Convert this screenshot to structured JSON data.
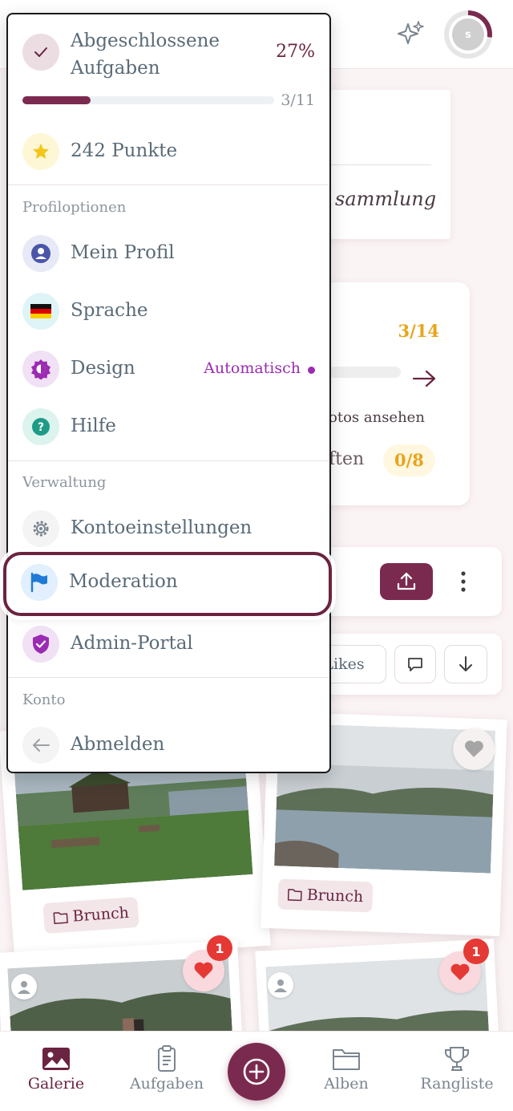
{
  "topbar": {
    "avatar_initial": "s"
  },
  "background": {
    "album_card_text": "sammlung",
    "task_card": {
      "count": "3/14",
      "line1": "otos ansehen",
      "line2": "ften",
      "sub_count": "0/8"
    },
    "sort": {
      "likes_label": "Likes"
    }
  },
  "photos": [
    {
      "tag": "Brunch"
    },
    {
      "tag": "Brunch"
    },
    {
      "likes_count": "1"
    },
    {
      "likes_count": "1"
    }
  ],
  "menu": {
    "progress": {
      "label": "Abgeschlossene Aufgaben",
      "percent_text": "27%",
      "fraction": 0.27,
      "count": "3/11"
    },
    "points": "242 Punkte",
    "sections": {
      "profile": "Profiloptionen",
      "admin": "Verwaltung",
      "account": "Konto"
    },
    "items": {
      "my_profile": "Mein Profil",
      "language": "Sprache",
      "design": "Design",
      "design_value": "Automatisch",
      "help": "Hilfe",
      "account_settings": "Kontoeinstellungen",
      "moderation": "Moderation",
      "admin_portal": "Admin-Portal",
      "logout": "Abmelden"
    }
  },
  "bottom_nav": {
    "gallery": "Galerie",
    "tasks": "Aufgaben",
    "albums": "Alben",
    "leaderboard": "Rangliste"
  },
  "colors": {
    "brand": "#7b2a4f",
    "accent_gold": "#e8a41a",
    "design_purple": "#9b2bb3"
  }
}
